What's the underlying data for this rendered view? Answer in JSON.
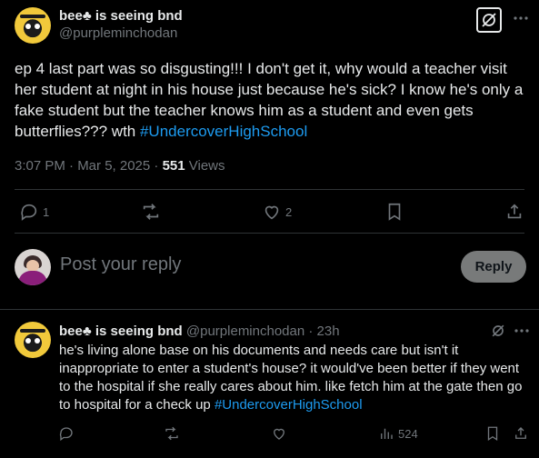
{
  "post": {
    "display_name": "bee♣ is seeing bnd",
    "handle": "@purpleminchodan",
    "text_before_link": "ep 4 last part was so disgusting!!! I don't get it, why would a teacher visit her student at night in his house just because he's sick? I know he's only a fake student but the teacher knows him as a student and even gets butterflies??? wth ",
    "hashtag": "#UndercoverHighSchool",
    "time": "3:07 PM · Mar 5, 2025 · ",
    "views_count": "551",
    "views_label": " Views",
    "replies_count": "1",
    "likes_count": "2"
  },
  "composer": {
    "placeholder": "Post your reply",
    "reply_button": "Reply"
  },
  "reply": {
    "display_name": "bee♣ is seeing bnd",
    "handle": "@purpleminchodan",
    "time": " · 23h",
    "text_before_link": "he's living alone base on his documents and needs care but isn't it inappropriate to enter a student's house? it would've been better if they went to the hospital if she really cares about him. like fetch him at the gate then go to hospital for a check up ",
    "hashtag": "#UndercoverHighSchool",
    "views_count": "524"
  },
  "icons": {
    "grok": "grok-icon",
    "more": "more-icon",
    "reply": "reply-icon",
    "repost": "repost-icon",
    "like": "heart-icon",
    "bookmark": "bookmark-icon",
    "share": "share-icon",
    "views": "views-icon"
  },
  "colors": {
    "background": "#000000",
    "text": "#e7e9ea",
    "muted": "#71767b",
    "link": "#1d9bf0",
    "divider": "#2f3336"
  }
}
